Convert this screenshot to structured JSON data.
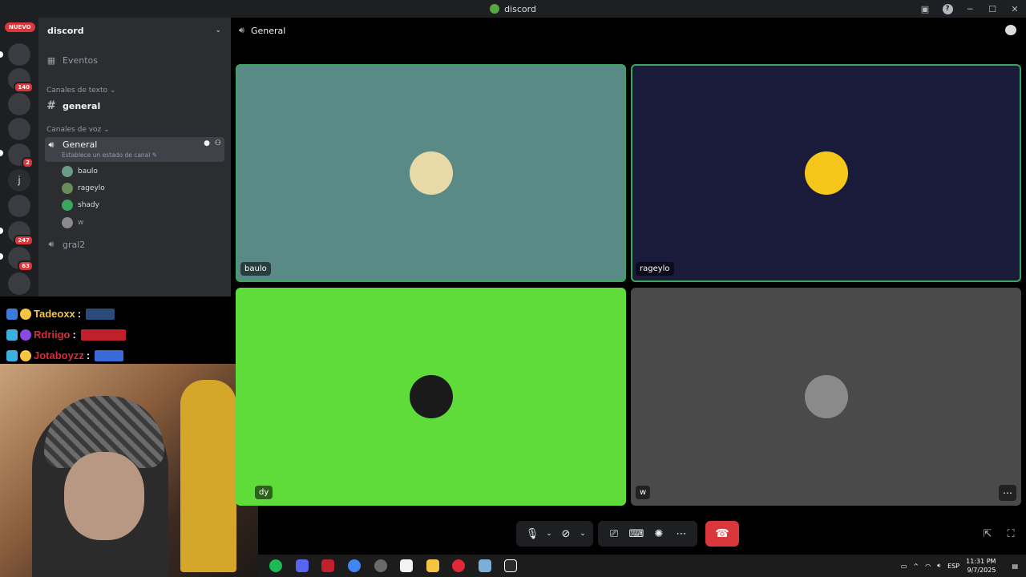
{
  "window": {
    "title": "discord"
  },
  "rail": {
    "new_label": "NUEVO",
    "servers": [
      {
        "name": "server-1",
        "badge": "",
        "color": "#6b7a3a"
      },
      {
        "name": "server-2",
        "badge": "140",
        "color": "#4a4a4a"
      },
      {
        "name": "server-3",
        "badge": "",
        "color": "#d8202a"
      },
      {
        "name": "server-4",
        "badge": "",
        "color": "#1e1f22"
      },
      {
        "name": "server-5",
        "badge": "2",
        "color": "#6a5aa0"
      },
      {
        "name": "server-6",
        "letter": "j",
        "badge": ""
      },
      {
        "name": "server-7",
        "badge": "",
        "color": "#f2f3f5"
      },
      {
        "name": "server-8",
        "badge": "247",
        "color": "#8a5a3a"
      },
      {
        "name": "server-9",
        "badge": "63",
        "color": "#b01a1a"
      },
      {
        "name": "server-10",
        "badge": "",
        "color": "#3a3a3a"
      }
    ]
  },
  "sidebar": {
    "server_name": "discord",
    "events_label": "Eventos",
    "text_category": "Canales de texto",
    "text_channel": "general",
    "voice_category": "Canales de voz",
    "voice_channel": "General",
    "voice_status_hint": "Establece un estado de canal",
    "voice_users": [
      {
        "name": "baulo",
        "color": "#6b9a88"
      },
      {
        "name": "rageylo",
        "color": "#6b8c5a"
      },
      {
        "name": "shady",
        "color": "#3aa55d"
      },
      {
        "name": "w",
        "color": "#8a8a8a"
      }
    ],
    "voice_channel_2": "gral2"
  },
  "overlay_chat": [
    {
      "user": "Tadeoxx",
      "color": "#f5c542",
      "sep": ":"
    },
    {
      "user": "Rdriigo",
      "color": "#e0283a",
      "sep": ":"
    },
    {
      "user": "Jotaboyzz",
      "color": "#e0283a",
      "sep": ":"
    }
  ],
  "channel_header": {
    "title": "General"
  },
  "tiles": [
    {
      "name": "baulo",
      "bg": "#5a8a86",
      "avatar": "#e8d9a8",
      "speaking": true
    },
    {
      "name": "rageylo",
      "bg": "#1a1a3a",
      "avatar": "#f5c71a",
      "speaking": true
    },
    {
      "name": "shady",
      "label": "dy",
      "bg": "#5fdc3a",
      "avatar": "#1a1a1a",
      "speaking": false
    },
    {
      "name": "w",
      "bg": "#4a4a4a",
      "avatar": "#8a8a8a",
      "speaking": false
    }
  ],
  "tray": {
    "lang": "ESP",
    "time": "11:31 PM",
    "date": "9/7/2025"
  }
}
